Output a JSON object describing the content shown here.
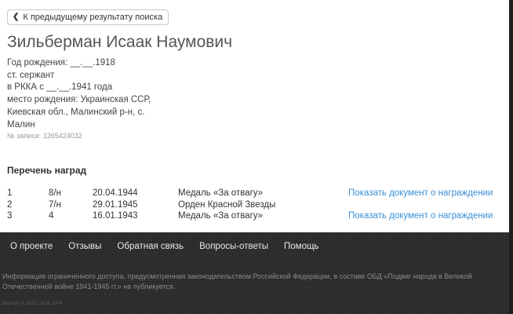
{
  "back_button": {
    "label": "К предыдущему результату поиска",
    "icon": "chevron-left-icon"
  },
  "person": {
    "name": "Зильберман Исаак Наумович",
    "birth": "Год рождения: __.__.1918",
    "rank": "ст. сержант",
    "service": "в РККА с __.__.1941 года",
    "birthplace_line1": "место рождения: Украинская ССР,",
    "birthplace_line2": "Киевская обл., Малинский р-н, с.",
    "birthplace_line3": "Малин",
    "record": "№ записи: 1265424032"
  },
  "awards": {
    "title": "Перечень наград",
    "rows": [
      {
        "num": "1",
        "code": "8/н",
        "date": "20.04.1944",
        "name": "Медаль «За отвагу»",
        "link": "Показать документ о награждении"
      },
      {
        "num": "2",
        "code": "7/н",
        "date": "29.01.1945",
        "name": "Орден Красной Звезды",
        "link": ""
      },
      {
        "num": "3",
        "code": "4",
        "date": "16.01.1943",
        "name": "Медаль «За отвагу»",
        "link": "Показать документ о награждении"
      }
    ]
  },
  "footer": {
    "nav": [
      "О проекте",
      "Отзывы",
      "Обратная связь",
      "Вопросы-ответы",
      "Помощь"
    ],
    "notice": "Информация ограниченного доступа, предусмотренная законодательством Российской Федерации, в составе ОБД «Подвиг народа в Великой Отечественной войне 1941-1945 гг.» не публикуется.",
    "version": "Версия от 16.07.16.01.2014"
  },
  "colors": {
    "link": "#3a8fd6",
    "footer_bg": "#2a2a2a"
  }
}
